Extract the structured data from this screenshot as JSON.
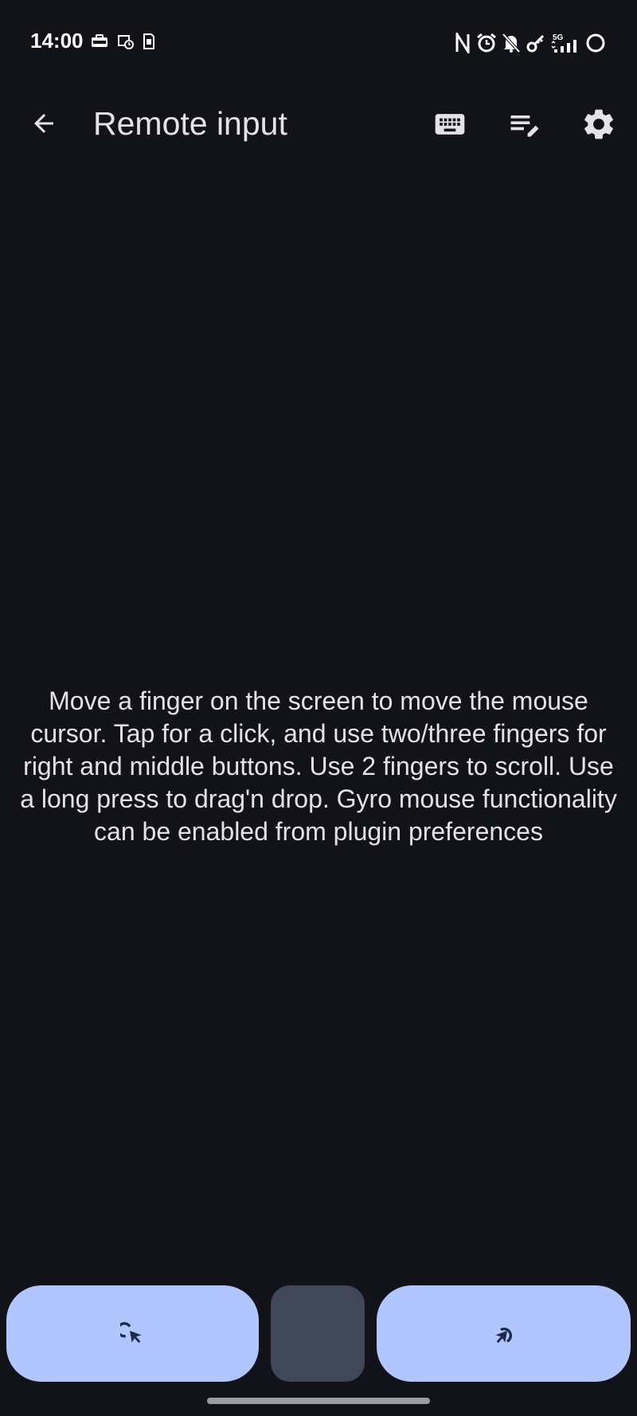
{
  "status_bar": {
    "time": "14:00",
    "left_icons": [
      "cmhg-icon",
      "calendar-clock-icon",
      "sim-icon"
    ],
    "right_icons": [
      "nfc-icon",
      "alarm-icon",
      "bell-off-icon",
      "key-icon",
      "signal-5g-icon",
      "battery-ring-icon"
    ],
    "network_label": "5G"
  },
  "app_bar": {
    "title": "Remote input",
    "actions": [
      "keyboard-icon",
      "edit-list-icon",
      "settings-icon"
    ]
  },
  "main": {
    "instructions": "Move a finger on the screen to move the mouse cursor. Tap for a click, and use two/three fingers for right and middle buttons. Use 2 fingers to scroll. Use a long press to drag'n drop. Gyro mouse functionality can be enabled from plugin preferences"
  },
  "bottom_buttons": {
    "left": "left-click-icon",
    "middle": "middle-click",
    "right": "right-click-icon"
  },
  "colors": {
    "background": "#121318",
    "primary_container": "#b1c5ff",
    "secondary_container": "#3f4759",
    "on_surface": "#e3e2e9"
  }
}
